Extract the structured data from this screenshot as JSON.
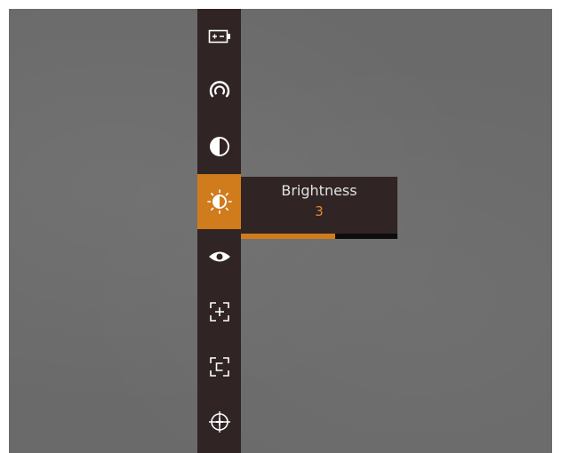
{
  "menu": {
    "items": [
      {
        "icon": "battery-icon"
      },
      {
        "icon": "hotspot-tracking-icon"
      },
      {
        "icon": "contrast-icon"
      },
      {
        "icon": "brightness-icon",
        "active": true
      },
      {
        "icon": "eye-icon"
      },
      {
        "icon": "zoom-in-icon"
      },
      {
        "icon": "calibration-icon"
      },
      {
        "icon": "crosshair-icon"
      }
    ]
  },
  "brightness_popup": {
    "title": "Brightness",
    "value": "3",
    "level_fraction": 0.6
  },
  "colors": {
    "accent": "#d07b1c",
    "menu_bg": "#302424",
    "value_text": "#e08a2a"
  }
}
